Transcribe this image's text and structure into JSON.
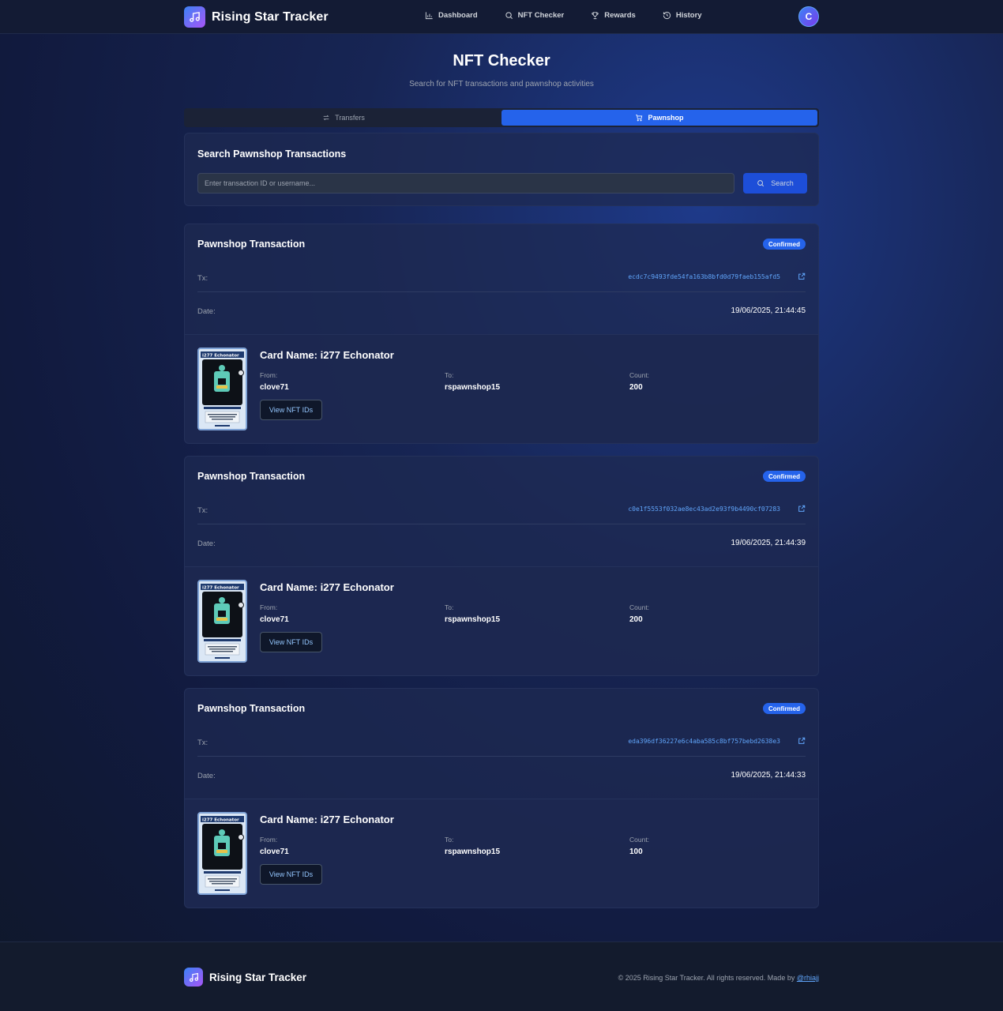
{
  "brand": {
    "name": "Rising Star Tracker",
    "icon": "music-note-icon"
  },
  "nav": {
    "links": [
      {
        "label": "Dashboard",
        "icon": "bar-chart-icon"
      },
      {
        "label": "NFT Checker",
        "icon": "search-icon"
      },
      {
        "label": "Rewards",
        "icon": "trophy-icon"
      },
      {
        "label": "History",
        "icon": "history-icon"
      }
    ],
    "avatar_initial": "C"
  },
  "header": {
    "title": "NFT Checker",
    "subtitle": "Search for NFT transactions and pawnshop activities"
  },
  "tabs": [
    {
      "label": "Transfers",
      "icon": "arrows-swap-icon",
      "active": false
    },
    {
      "label": "Pawnshop",
      "icon": "cart-icon",
      "active": true
    }
  ],
  "search": {
    "heading": "Search Pawnshop Transactions",
    "placeholder": "Enter transaction ID or username...",
    "value": "",
    "button_label": "Search"
  },
  "labels": {
    "tx": "Tx:",
    "date": "Date:",
    "from": "From:",
    "to": "To:",
    "count": "Count:",
    "view_button": "View NFT IDs"
  },
  "transactions": [
    {
      "title": "Pawnshop Transaction",
      "status": "Confirmed",
      "tx": "ecdc7c9493fde54fa163b8bfd0d79faeb155afd5",
      "date": "19/06/2025, 21:44:45",
      "card_name": "Card Name: i277 Echonator",
      "from": "clove71",
      "to": "rspawnshop15",
      "count": "200"
    },
    {
      "title": "Pawnshop Transaction",
      "status": "Confirmed",
      "tx": "c0e1f5553f032ae8ec43ad2e93f9b4490cf07283",
      "date": "19/06/2025, 21:44:39",
      "card_name": "Card Name: i277 Echonator",
      "from": "clove71",
      "to": "rspawnshop15",
      "count": "200"
    },
    {
      "title": "Pawnshop Transaction",
      "status": "Confirmed",
      "tx": "eda396df36227e6c4aba585c8bf757bebd2638e3",
      "date": "19/06/2025, 21:44:33",
      "card_name": "Card Name: i277 Echonator",
      "from": "clove71",
      "to": "rspawnshop15",
      "count": "100"
    }
  ],
  "nft_card_art": {
    "banner": "i277 Echonator"
  },
  "footer": {
    "brand": "Rising Star Tracker",
    "copyright": "© 2025 Rising Star Tracker. All rights reserved. Made by",
    "author": "@rhiajj"
  },
  "colors": {
    "accent": "#2563eb",
    "link": "#60a5fa",
    "background": "#172554"
  }
}
